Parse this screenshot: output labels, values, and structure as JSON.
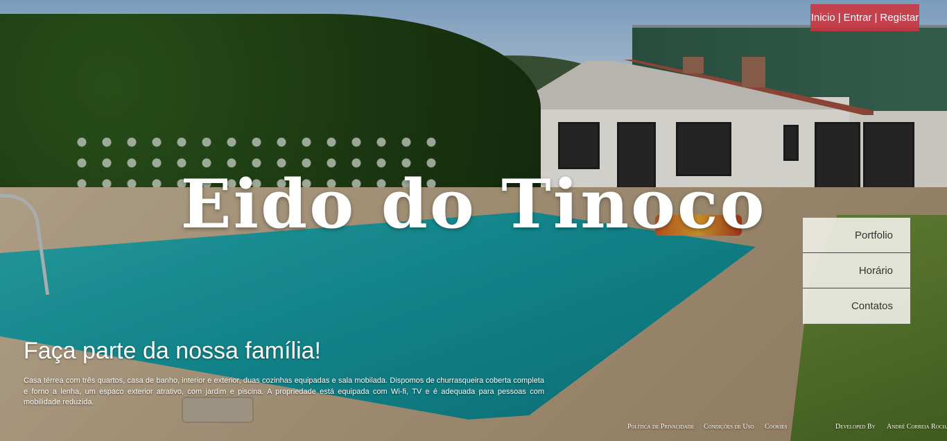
{
  "nav": {
    "home": "Inicio",
    "login": "Entrar",
    "register": "Registar",
    "separator": "|"
  },
  "site": {
    "title": "Eido do Tinoco"
  },
  "sidemenu": {
    "items": [
      {
        "label": "Portfolio"
      },
      {
        "label": "Horário"
      },
      {
        "label": "Contatos"
      }
    ]
  },
  "hero": {
    "tagline": "Faça parte da nossa família!",
    "description": "Casa térrea com três quartos, casa de banho, interior e exterior, duas cozinhas equipadas e sala mobilada. Dispomos de churrasqueira coberta completa e forno a lenha, um espaco exterior atrativo, com jardim e piscina. A propriedade está equipada com Wi-fi, TV e é adequada para pessoas com mobilidade reduzida."
  },
  "footer": {
    "privacy": "Política de Privacidade",
    "terms": "Condições de Uso",
    "cookies": "Cookies",
    "developed_by": "Developed By",
    "developer": "André Correia Rocha"
  },
  "colors": {
    "nav_bg": "#cd343e",
    "menu_bg": "#f0f0e8"
  }
}
